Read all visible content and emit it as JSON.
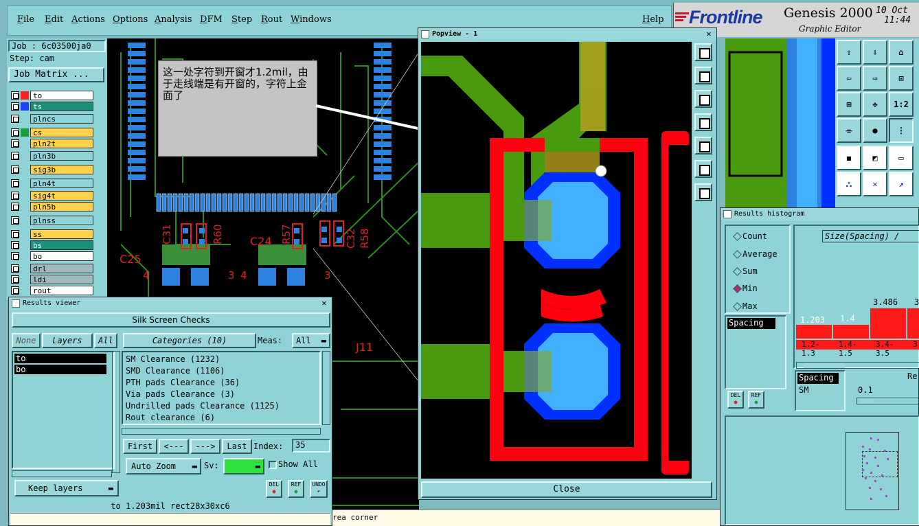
{
  "menubar": {
    "items": [
      "File",
      "Edit",
      "Actions",
      "Options",
      "Analysis",
      "DFM",
      "Step",
      "Rout",
      "Windows"
    ],
    "help": "Help"
  },
  "header": {
    "brand": "Frontline",
    "product": "Genesis 2000",
    "subtitle": "Graphic Editor",
    "date": "10 Oct",
    "time": "11:44"
  },
  "job": {
    "job_label": "Job : 6c03500ja0",
    "step_label": "Step: cam",
    "matrix_button": "Job Matrix ..."
  },
  "layers": [
    {
      "name": "to",
      "color": "#ff2020",
      "bg": "#ffffff"
    },
    {
      "name": "ts",
      "color": "#2040ff",
      "bg": "#1a8f7a"
    },
    {
      "name": "plncs",
      "color": "",
      "bg": "#8fd3d6"
    },
    {
      "name": "cs",
      "color": "#1a9e3a",
      "bg": "#ffd24a"
    },
    {
      "name": "pln2t",
      "color": "",
      "bg": "#ffd24a"
    },
    {
      "name": "pln3b",
      "color": "",
      "bg": "#8fd3d6"
    },
    {
      "name": "sig3b",
      "color": "",
      "bg": "#ffd24a"
    },
    {
      "name": "pln4t",
      "color": "",
      "bg": "#8fd3d6"
    },
    {
      "name": "sig4t",
      "color": "",
      "bg": "#ffd24a"
    },
    {
      "name": "pln5b",
      "color": "",
      "bg": "#ffd24a"
    },
    {
      "name": "plnss",
      "color": "",
      "bg": "#8fd3d6"
    },
    {
      "name": "ss",
      "color": "",
      "bg": "#ffd24a"
    },
    {
      "name": "bs",
      "color": "",
      "bg": "#1a8f7a"
    },
    {
      "name": "bo",
      "color": "",
      "bg": "#ffffff"
    },
    {
      "name": "drl",
      "color": "",
      "bg": "#a0b8c0"
    },
    {
      "name": "ldi",
      "color": "",
      "bg": "#a0b8c0"
    },
    {
      "name": "rout",
      "color": "",
      "bg": "#ffffff"
    }
  ],
  "callout": {
    "text": "这一处字符到开窗才1.2mil，由于走线端是有开窗的，字符上金面了"
  },
  "pcb_labels": [
    "C31",
    "R60",
    "C24",
    "R57",
    "C32",
    "R58",
    "C25",
    "4",
    "3",
    "4",
    "3",
    "J11"
  ],
  "popview": {
    "title": "Popview - 1",
    "close_button": "Close"
  },
  "results_viewer": {
    "title": "Results viewer",
    "heading": "Silk Screen Checks",
    "none_btn": "None",
    "layers_btn": "Layers",
    "all_btn": "All",
    "layer_items": [
      "to",
      "bo"
    ],
    "categories_btn": "Categories (10)",
    "meas_label": "Meas:",
    "meas_value": "All",
    "categories": [
      "SM Clearance (1232)",
      "SMD Clearance (1106)",
      "PTH pads Clearance (36)",
      "Via pads Clearance (3)",
      "Undrilled pads Clearance (1125)",
      "Rout clearance (6)"
    ],
    "first_btn": "First",
    "prev_btn": "<---",
    "next_btn": "--->",
    "last_btn": "Last",
    "index_label": "Index:",
    "index_value": "35",
    "auto_zoom_btn": "Auto Zoom",
    "sv_label": "Sv:",
    "show_all_label": "Show All",
    "keep_layers_btn": "Keep layers",
    "del_label": "DEL",
    "ref_label": "REF",
    "undo_label": "UNDO",
    "status": "to 1.203mil   rect28x30xc6"
  },
  "bottom_status": "rea corner",
  "histogram": {
    "title": "Results histogram",
    "options": [
      "Count",
      "Average",
      "Sum",
      "Min",
      "Max"
    ],
    "selected": "Min",
    "size_label": "Size(Spacing) /",
    "list_item": "Spacing",
    "bars": [
      {
        "value": "1.203",
        "range": "1.2-\n1.3"
      },
      {
        "value": "1.4",
        "range": "1.4-\n1.5"
      },
      {
        "value": "3.486",
        "range": "3.4-\n3.5"
      },
      {
        "value": "3",
        "range": "3"
      }
    ],
    "spacing_label": "Spacing",
    "sm_label": "SM",
    "re_label": "Re",
    "val_01": "0.1",
    "del_label": "DEL",
    "ref_label": "REF"
  },
  "toolgrid": {
    "one_two": "1:2"
  }
}
